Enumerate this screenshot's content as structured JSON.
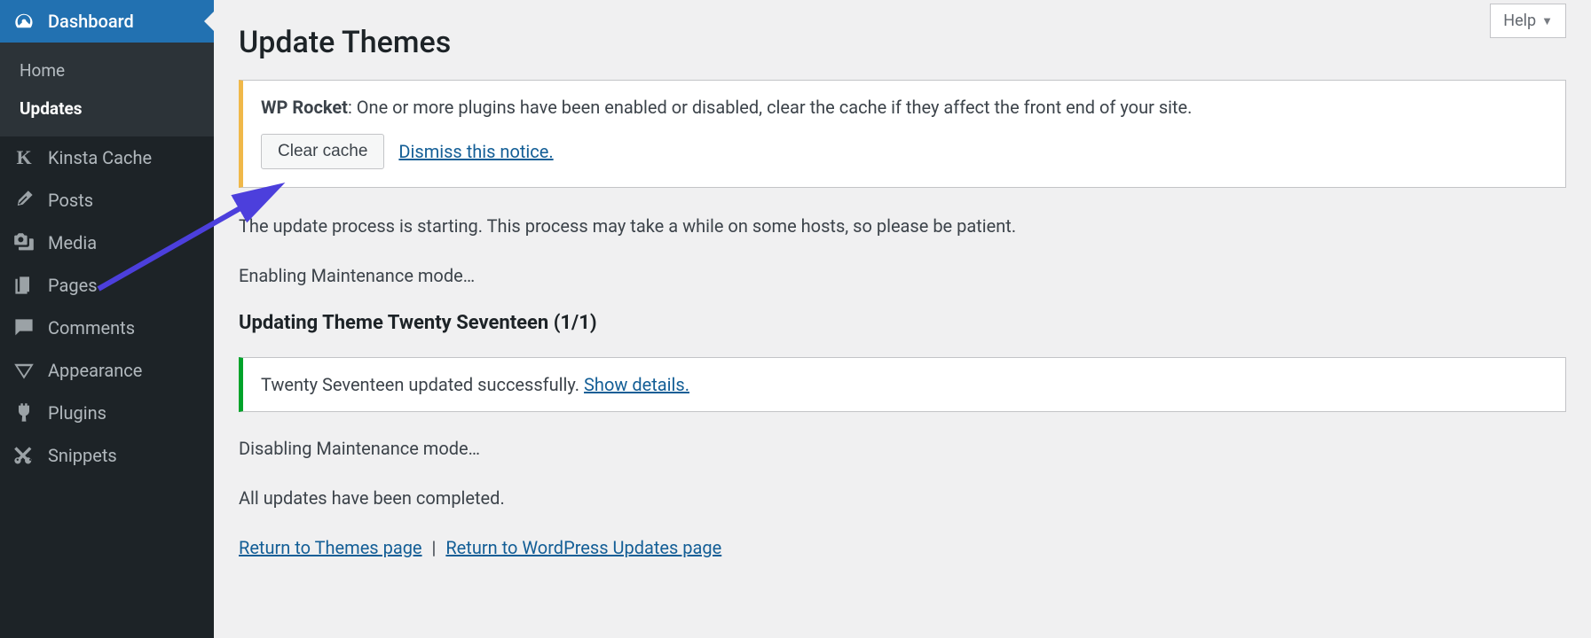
{
  "sidebar": {
    "dashboard": {
      "label": "Dashboard"
    },
    "submenu": [
      {
        "label": "Home"
      },
      {
        "label": "Updates"
      }
    ],
    "items": [
      {
        "label": "Kinsta Cache"
      },
      {
        "label": "Posts"
      },
      {
        "label": "Media"
      },
      {
        "label": "Pages"
      },
      {
        "label": "Comments"
      },
      {
        "label": "Appearance"
      },
      {
        "label": "Plugins"
      },
      {
        "label": "Snippets"
      }
    ]
  },
  "help": {
    "label": "Help"
  },
  "page": {
    "title": "Update Themes"
  },
  "notice": {
    "plugin_name": "WP Rocket",
    "text": ": One or more plugins have been enabled or disabled, clear the cache if they affect the front end of your site.",
    "clear_cache": "Clear cache",
    "dismiss": "Dismiss this notice."
  },
  "log": {
    "starting": "The update process is starting. This process may take a while on some hosts, so please be patient.",
    "enable_maint": "Enabling Maintenance mode…",
    "updating_heading": "Updating Theme Twenty Seventeen (1/1)",
    "success_prefix": "Twenty Seventeen updated successfully. ",
    "show_details": "Show details.",
    "disable_maint": "Disabling Maintenance mode…",
    "completed": "All updates have been completed.",
    "return_themes": "Return to Themes page",
    "return_updates": "Return to WordPress Updates page",
    "sep": " | "
  }
}
